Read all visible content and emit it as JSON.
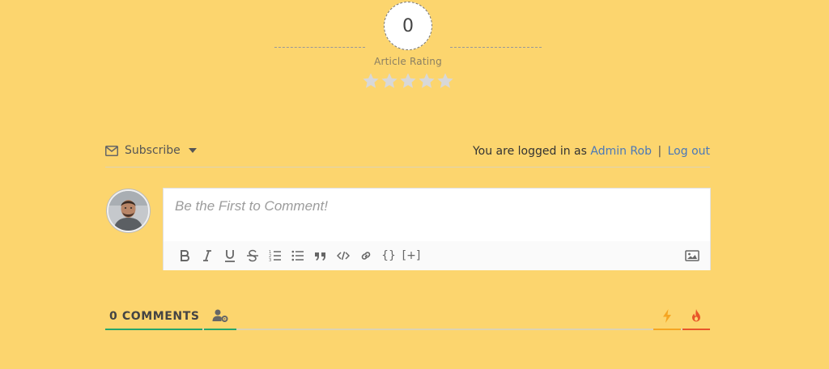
{
  "rating": {
    "value": "0",
    "label": "Article Rating",
    "stars_filled": 0,
    "stars_total": 5,
    "star_color": "#d8d8d8"
  },
  "subscribe": {
    "label": "Subscribe",
    "icon": "envelope-icon"
  },
  "login": {
    "prefix": "You are logged in as",
    "user": "Admin Rob",
    "separator": "|",
    "logout": "Log out"
  },
  "comment_box": {
    "placeholder": "Be the First to Comment!"
  },
  "toolbar": {
    "buttons": [
      "bold-icon",
      "italic-icon",
      "underline-icon",
      "strikethrough-icon",
      "ordered-list-icon",
      "unordered-list-icon",
      "blockquote-icon",
      "code-icon",
      "link-icon",
      "source-code-icon",
      "spoiler-icon",
      "image-icon"
    ],
    "source_label": "{}",
    "spoiler_label": "[+]"
  },
  "comments_bar": {
    "count_label": "0 COMMENTS",
    "accent_green": "#26a66b",
    "accent_orange": "#f5a623",
    "accent_red": "#e8562a"
  }
}
